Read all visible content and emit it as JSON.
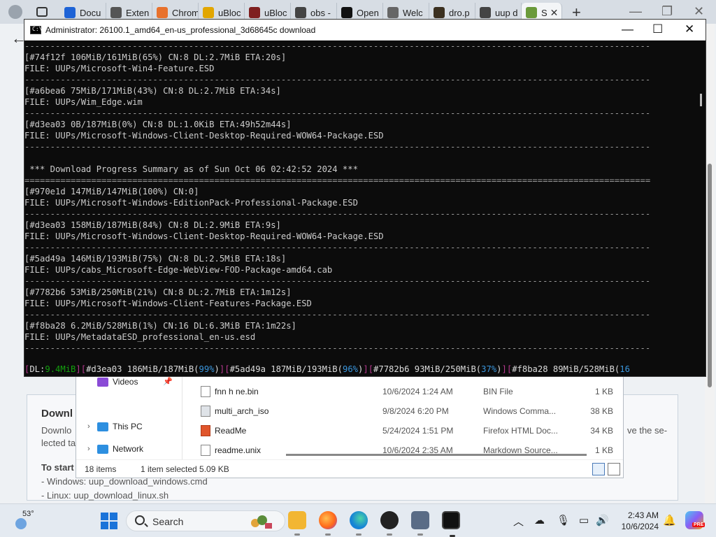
{
  "browser": {
    "tabs": [
      {
        "label": "Docu",
        "color": "#1e63d6",
        "glyph": ""
      },
      {
        "label": "Exten",
        "color": "#555555",
        "glyph": ""
      },
      {
        "label": "Chrom",
        "color": "#e8712c",
        "glyph": ""
      },
      {
        "label": "uBloc",
        "color": "#e2a600",
        "glyph": ""
      },
      {
        "label": "uBloc",
        "color": "#7f1f1f",
        "glyph": ""
      },
      {
        "label": "obs -",
        "color": "#444444",
        "glyph": ""
      },
      {
        "label": "Open",
        "color": "#111111",
        "glyph": ""
      },
      {
        "label": "Welc",
        "color": "#666666",
        "glyph": ""
      },
      {
        "label": "dro.p",
        "color": "#3b3020",
        "glyph": ""
      },
      {
        "label": "uup d",
        "color": "#444444",
        "glyph": ""
      },
      {
        "label": "S",
        "color": "#6a9a3a",
        "glyph": "",
        "active": true
      }
    ],
    "close_glyph": "✕",
    "new_tab_glyph": "+",
    "window_buttons": {
      "minimize": "—",
      "restore": "❐",
      "close": "✕"
    }
  },
  "webpage": {
    "back_glyph": "←",
    "section_title": "Downl",
    "desc_left": "Downlo lected ta",
    "desc_right": "ve the se-",
    "to_start": "To start",
    "windows_line": "- Windows: uup_download_windows.cmd",
    "linux_line": "- Linux: uup_download_linux.sh"
  },
  "explorer": {
    "nav": [
      {
        "label": "Videos",
        "chevron": "",
        "icon_color": "#8a4bd6"
      },
      {
        "label": "This PC",
        "chevron": "›",
        "icon_color": "#2d8fe0"
      },
      {
        "label": "Network",
        "chevron": "›",
        "icon_color": "#2d8fe0"
      }
    ],
    "pin_glyph": "📌",
    "files": [
      {
        "name": "fnn h ne.bin",
        "date": "10/6/2024 1:24 AM",
        "type": "BIN File",
        "size": "1 KB",
        "icon_color": "#ffffff"
      },
      {
        "name": "multi_arch_iso",
        "date": "9/8/2024 6:20 PM",
        "type": "Windows Comma...",
        "size": "38 KB",
        "icon_color": "#dfe3e8"
      },
      {
        "name": "ReadMe",
        "date": "5/24/2024 1:51 PM",
        "type": "Firefox HTML Doc...",
        "size": "34 KB",
        "icon_color": "#e0552b"
      },
      {
        "name": "readme.unix",
        "date": "10/6/2024 2:35 AM",
        "type": "Markdown Source...",
        "size": "1 KB",
        "icon_color": "#ffffff"
      }
    ],
    "status_items": "18 items",
    "status_selected": "1 item selected  5.09 KB"
  },
  "console": {
    "title": "Administrator:  26100.1_amd64_en-us_professional_3d68645c download",
    "icon_text": "C:\\",
    "window_buttons": {
      "minimize": "—",
      "maximize": "☐",
      "close": "✕"
    },
    "lines": [
      {
        "text": "--------------------------------------------------------------------------------------------------------------------------",
        "sep": true
      },
      {
        "text": "[#74f12f 106MiB/161MiB(65%) CN:8 DL:2.7MiB ETA:20s]"
      },
      {
        "text": "FILE: UUPs/Microsoft-Win4-Feature.ESD"
      },
      {
        "text": "--------------------------------------------------------------------------------------------------------------------------",
        "sep": true
      },
      {
        "text": "[#a6bea6 75MiB/171MiB(43%) CN:8 DL:2.7MiB ETA:34s]"
      },
      {
        "text": "FILE: UUPs/Wim_Edge.wim"
      },
      {
        "text": "--------------------------------------------------------------------------------------------------------------------------",
        "sep": true
      },
      {
        "text": "[#d3ea03 0B/187MiB(0%) CN:8 DL:1.0KiB ETA:49h52m44s]"
      },
      {
        "text": "FILE: UUPs/Microsoft-Windows-Client-Desktop-Required-WOW64-Package.ESD"
      },
      {
        "text": "--------------------------------------------------------------------------------------------------------------------------",
        "sep": true
      },
      {
        "text": ""
      },
      {
        "text": " *** Download Progress Summary as of Sun Oct 06 02:42:52 2024 ***"
      },
      {
        "text": "==========================================================================================================================",
        "sep": true
      },
      {
        "text": "[#970e1d 147MiB/147MiB(100%) CN:0]"
      },
      {
        "text": "FILE: UUPs/Microsoft-Windows-EditionPack-Professional-Package.ESD"
      },
      {
        "text": "--------------------------------------------------------------------------------------------------------------------------",
        "sep": true
      },
      {
        "text": "[#d3ea03 158MiB/187MiB(84%) CN:8 DL:2.9MiB ETA:9s]"
      },
      {
        "text": "FILE: UUPs/Microsoft-Windows-Client-Desktop-Required-WOW64-Package.ESD"
      },
      {
        "text": "--------------------------------------------------------------------------------------------------------------------------",
        "sep": true
      },
      {
        "text": "[#5ad49a 146MiB/193MiB(75%) CN:8 DL:2.5MiB ETA:18s]"
      },
      {
        "text": "FILE: UUPs/cabs_Microsoft-Edge-WebView-FOD-Package-amd64.cab"
      },
      {
        "text": "--------------------------------------------------------------------------------------------------------------------------",
        "sep": true
      },
      {
        "text": "[#7782b6 53MiB/250MiB(21%) CN:8 DL:2.7MiB ETA:1m12s]"
      },
      {
        "text": "FILE: UUPs/Microsoft-Windows-Client-Features-Package.ESD"
      },
      {
        "text": "--------------------------------------------------------------------------------------------------------------------------",
        "sep": true
      },
      {
        "text": "[#f8ba28 6.2MiB/528MiB(1%) CN:16 DL:6.3MiB ETA:1m22s]"
      },
      {
        "text": "FILE: UUPs/MetadataESD_professional_en-us.esd"
      },
      {
        "text": "--------------------------------------------------------------------------------------------------------------------------",
        "sep": true
      },
      {
        "text": ""
      }
    ],
    "progress_line": [
      {
        "text": "[",
        "cls": "pl-brk"
      },
      {
        "text": "DL:",
        "cls": "pl-white"
      },
      {
        "text": "9.4MiB",
        "cls": "pl-dl"
      },
      {
        "text": "][",
        "cls": "pl-brk"
      },
      {
        "text": "#d3ea03 186MiB/187MiB(",
        "cls": "pl-white"
      },
      {
        "text": "99%",
        "cls": "pl-pct"
      },
      {
        "text": ")",
        "cls": "pl-white"
      },
      {
        "text": "][",
        "cls": "pl-brk"
      },
      {
        "text": "#5ad49a 187MiB/193MiB(",
        "cls": "pl-white"
      },
      {
        "text": "96%",
        "cls": "pl-pct"
      },
      {
        "text": ")",
        "cls": "pl-white"
      },
      {
        "text": "][",
        "cls": "pl-brk"
      },
      {
        "text": "#7782b6 93MiB/250MiB(",
        "cls": "pl-white"
      },
      {
        "text": "37%",
        "cls": "pl-pct"
      },
      {
        "text": ")",
        "cls": "pl-white"
      },
      {
        "text": "][",
        "cls": "pl-brk"
      },
      {
        "text": "#f8ba28 89MiB/528MiB(",
        "cls": "pl-white"
      },
      {
        "text": "16",
        "cls": "pl-pct"
      }
    ]
  },
  "taskbar": {
    "weather_temp": "53°",
    "search_label": "Search",
    "apps": [
      {
        "name": "file-explorer",
        "color": "#f2b632"
      },
      {
        "name": "firefox",
        "color": "#ff6a1a"
      },
      {
        "name": "edge",
        "color": "#1583d6"
      },
      {
        "name": "obs",
        "color": "#222222"
      },
      {
        "name": "device-manager",
        "color": "#5a6c86"
      },
      {
        "name": "terminal",
        "color": "#111111"
      }
    ],
    "tray": {
      "chevron": "︿",
      "network_off": "☁",
      "mic": "🎙",
      "display": "▭",
      "volume": "🔊"
    },
    "time": "2:43 AM",
    "date": "10/6/2024",
    "bell": "🔔",
    "copilot_badge": "PRE"
  }
}
